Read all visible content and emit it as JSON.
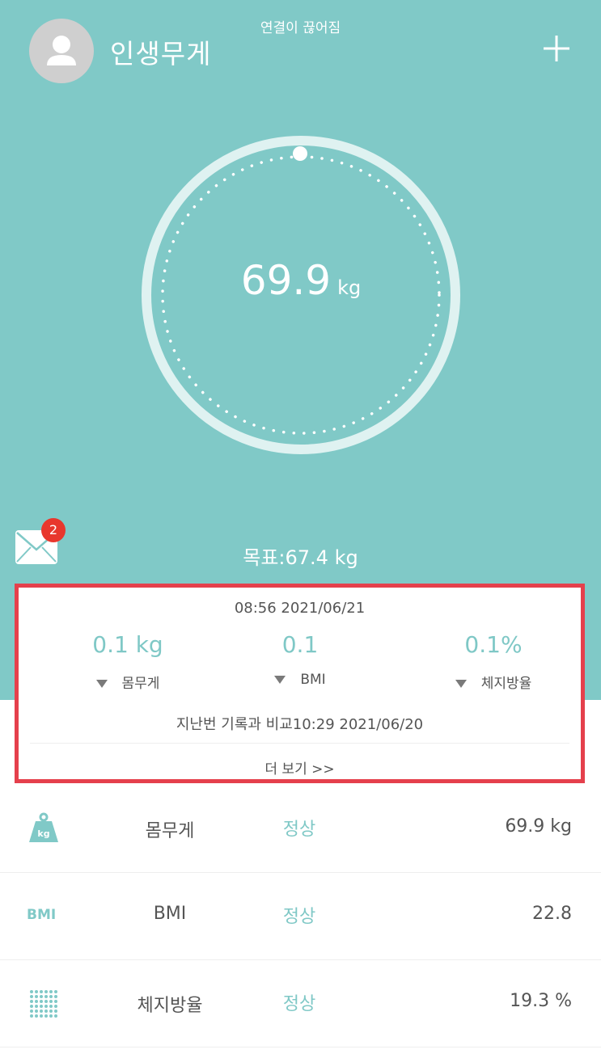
{
  "status_bar": {
    "text": "연결이 끊어짐"
  },
  "header": {
    "profile_name": "인생무게",
    "add_icon": "plus-icon",
    "avatar_icon": "person-icon"
  },
  "gauge": {
    "value": "69.9",
    "unit": "kg"
  },
  "goal": {
    "text": "목표:67.4 kg"
  },
  "mail": {
    "icon": "envelope-icon",
    "badge": "2"
  },
  "card": {
    "date": "08:56 2021/06/21",
    "stats": [
      {
        "value": "0.1 kg",
        "label": "몸무게",
        "trend": "down"
      },
      {
        "value": "0.1",
        "label": "BMI",
        "trend": "down"
      },
      {
        "value": "0.1%",
        "label": "체지방율",
        "trend": "down"
      }
    ],
    "compare": "지난번 기록과 비교10:29 2021/06/20",
    "more": "더 보기 >>"
  },
  "metrics": [
    {
      "icon": "weight-kg-icon",
      "name": "몸무게",
      "status": "정상",
      "value": "69.9 kg"
    },
    {
      "icon": "bmi-icon",
      "icon_text": "BMI",
      "name": "BMI",
      "status": "정상",
      "value": "22.8"
    },
    {
      "icon": "body-fat-dots-icon",
      "name": "체지방율",
      "status": "정상",
      "value": "19.3 %"
    }
  ],
  "colors": {
    "accent": "#80c9c7",
    "highlight_border": "#e5404c",
    "badge": "#e8372d"
  }
}
